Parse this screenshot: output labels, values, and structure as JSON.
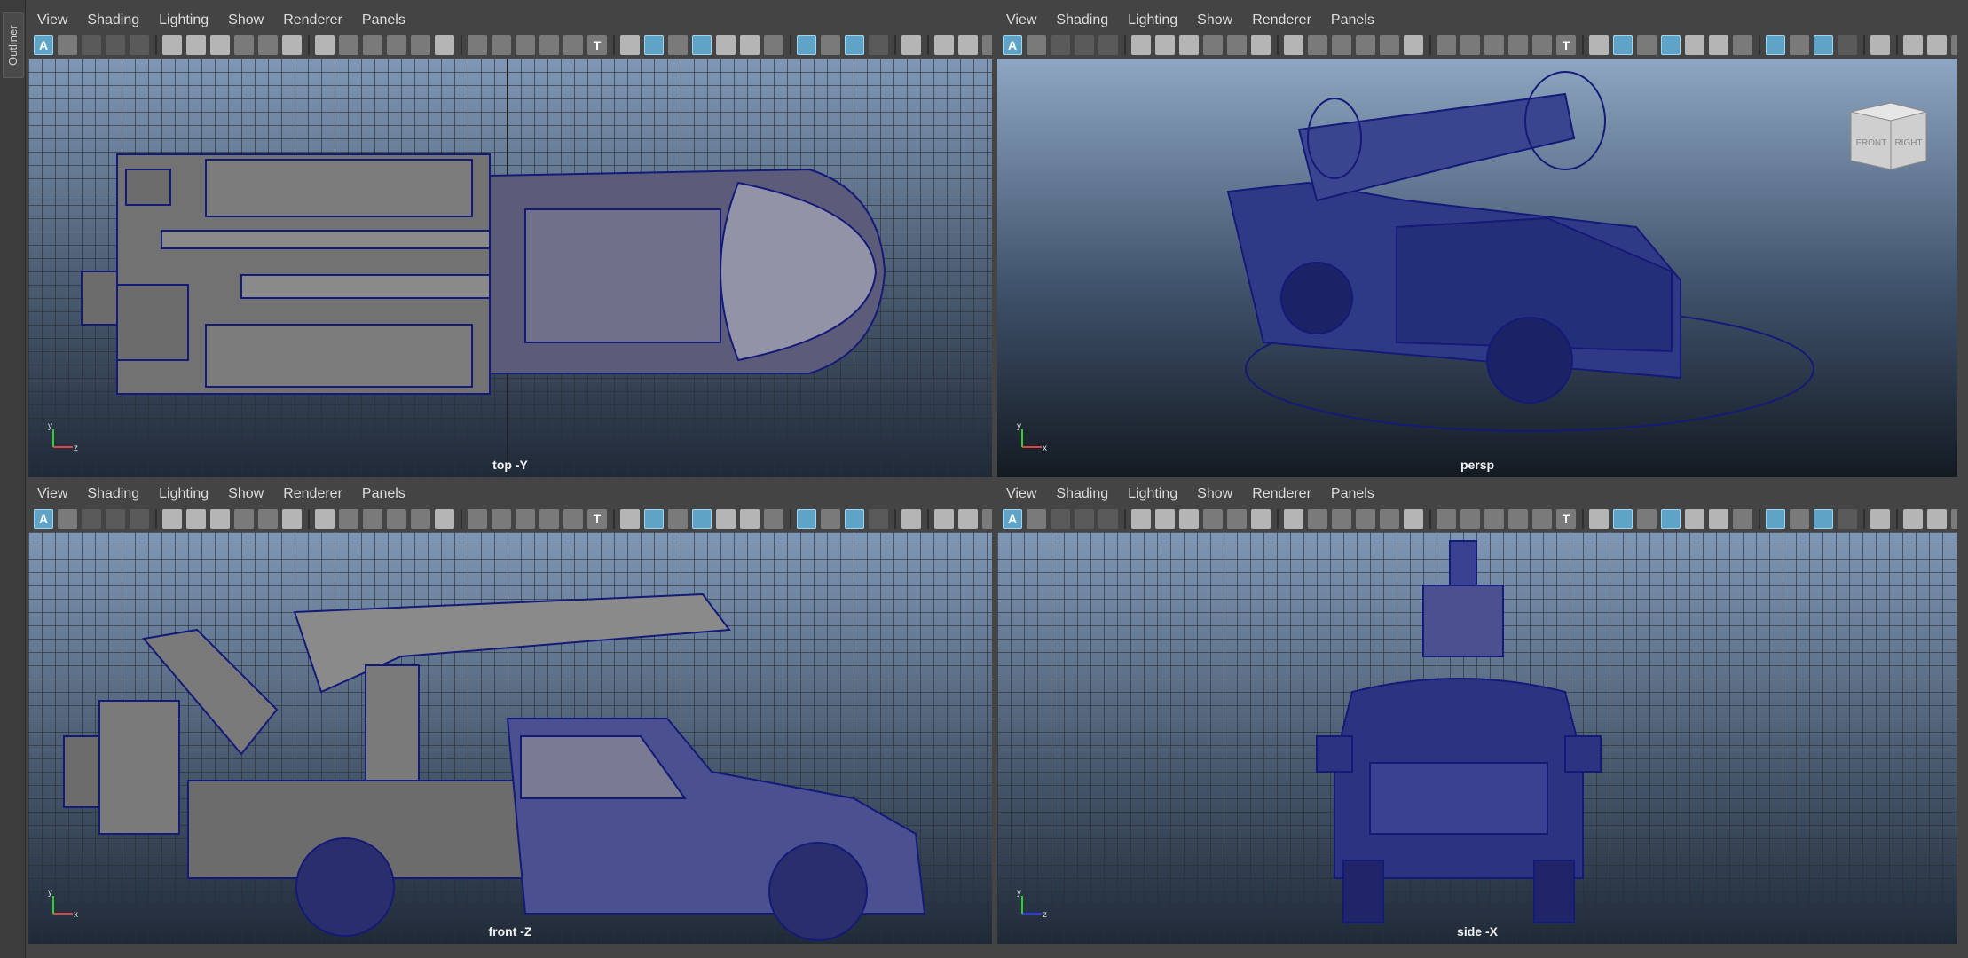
{
  "outliner": {
    "label": "Outliner"
  },
  "menu": [
    "View",
    "Shading",
    "Lighting",
    "Show",
    "Renderer",
    "Panels"
  ],
  "toolbar_text": {
    "auto_key": "A",
    "text_icon": "T"
  },
  "panels": {
    "top": {
      "camera": "top -Y",
      "axis": [
        "y",
        "z"
      ]
    },
    "persp": {
      "camera": "persp",
      "axis": [
        "y",
        "x"
      ],
      "viewcube": [
        "FRONT",
        "RIGHT"
      ]
    },
    "front": {
      "camera": "front -Z",
      "axis": [
        "y",
        "x"
      ]
    },
    "side": {
      "camera": "side -X",
      "axis": [
        "y",
        "z"
      ]
    }
  },
  "colors": {
    "viewport_top": "#7f97b5",
    "viewport_bottom": "#1f2a38",
    "persp_top": "#8ea6c2",
    "persp_bottom": "#141a22",
    "wireframe": "#141a78",
    "model_gray": "#6c6c6c",
    "grid": "#2a2f38",
    "toolbar_selected": "#5fa3c7"
  }
}
